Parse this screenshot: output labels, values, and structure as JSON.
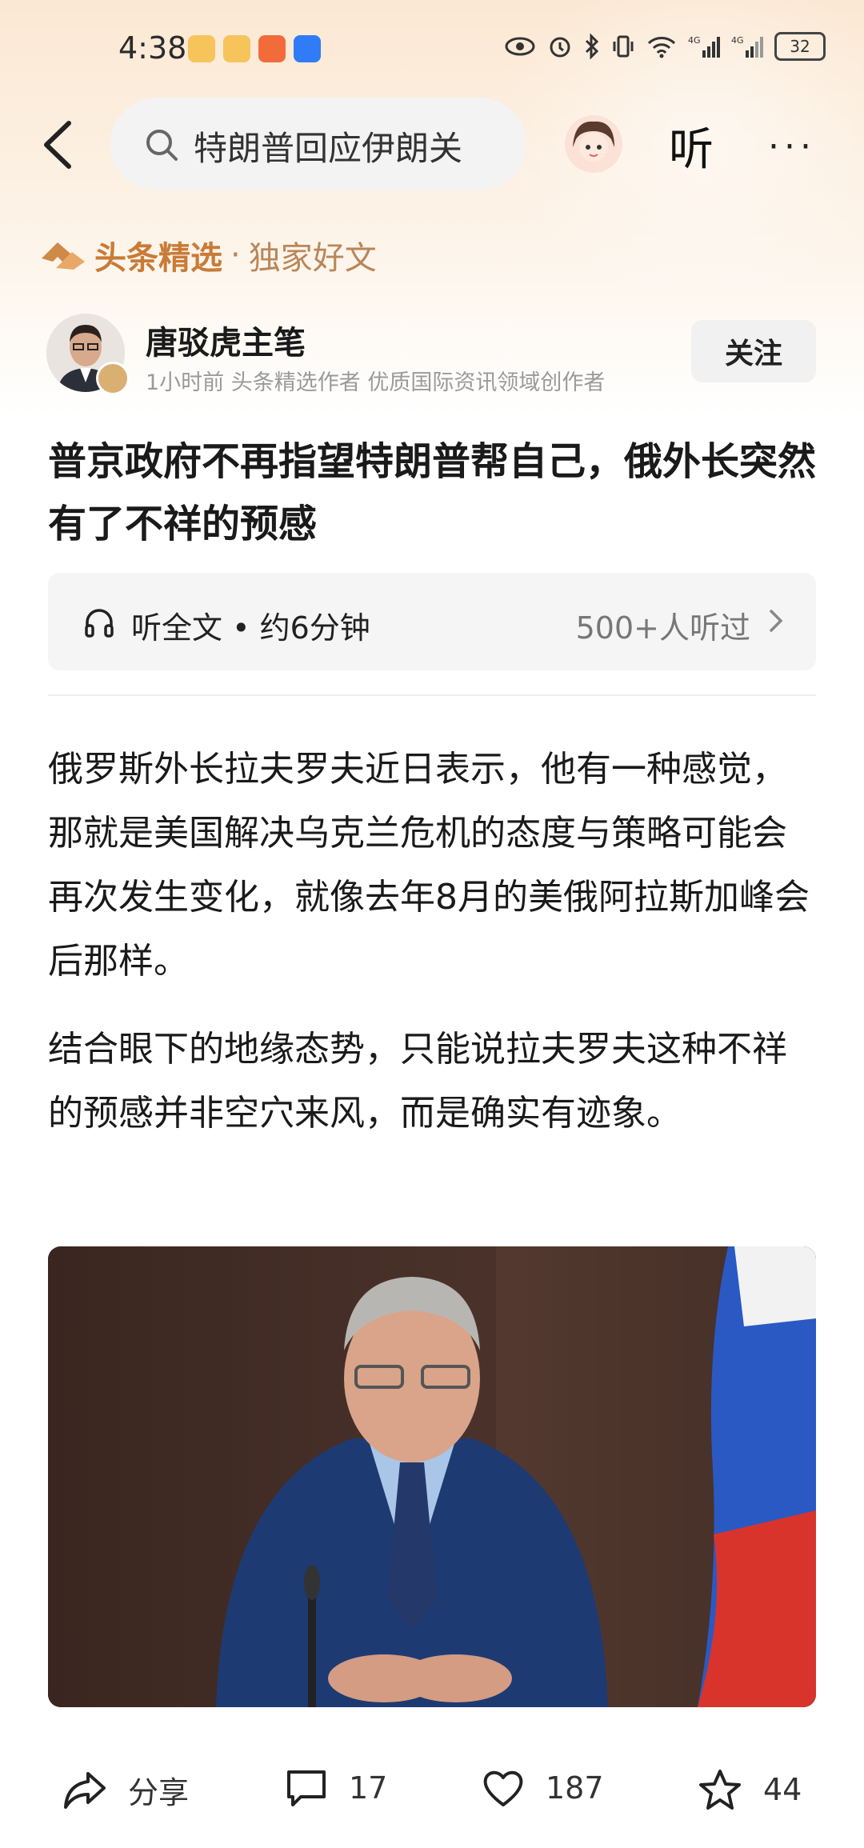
{
  "status_bar": {
    "time": "4:38",
    "battery": "32"
  },
  "header": {
    "search_text": "特朗普回应伊朗关",
    "listen_label": "听",
    "more_label": "···"
  },
  "brand": {
    "name": "头条精选",
    "separator": "·",
    "tagline": "独家好文"
  },
  "author": {
    "name": "唐驳虎主笔",
    "meta": "1小时前  头条精选作者 优质国际资讯领域创作者",
    "follow_label": "关注"
  },
  "article": {
    "title": "普京政府不再指望特朗普帮自己，俄外长突然有了不祥的预感",
    "listen_bar": {
      "label": "听全文 • 约6分钟",
      "count": "500+人听过"
    },
    "paragraphs": [
      "俄罗斯外长拉夫罗夫近日表示，他有一种感觉，那就是美国解决乌克兰危机的态度与策略可能会再次发生变化，就像去年8月的美俄阿拉斯加峰会后那样。",
      "结合眼下的地缘态势，只能说拉夫罗夫这种不祥的预感并非空穴来风，而是确实有迹象。"
    ]
  },
  "bottom_bar": {
    "share_label": "分享",
    "comments": "17",
    "likes": "187",
    "favorites": "44"
  },
  "colors": {
    "brand": "#c87b37",
    "header_bg": "#fbe8d3"
  }
}
